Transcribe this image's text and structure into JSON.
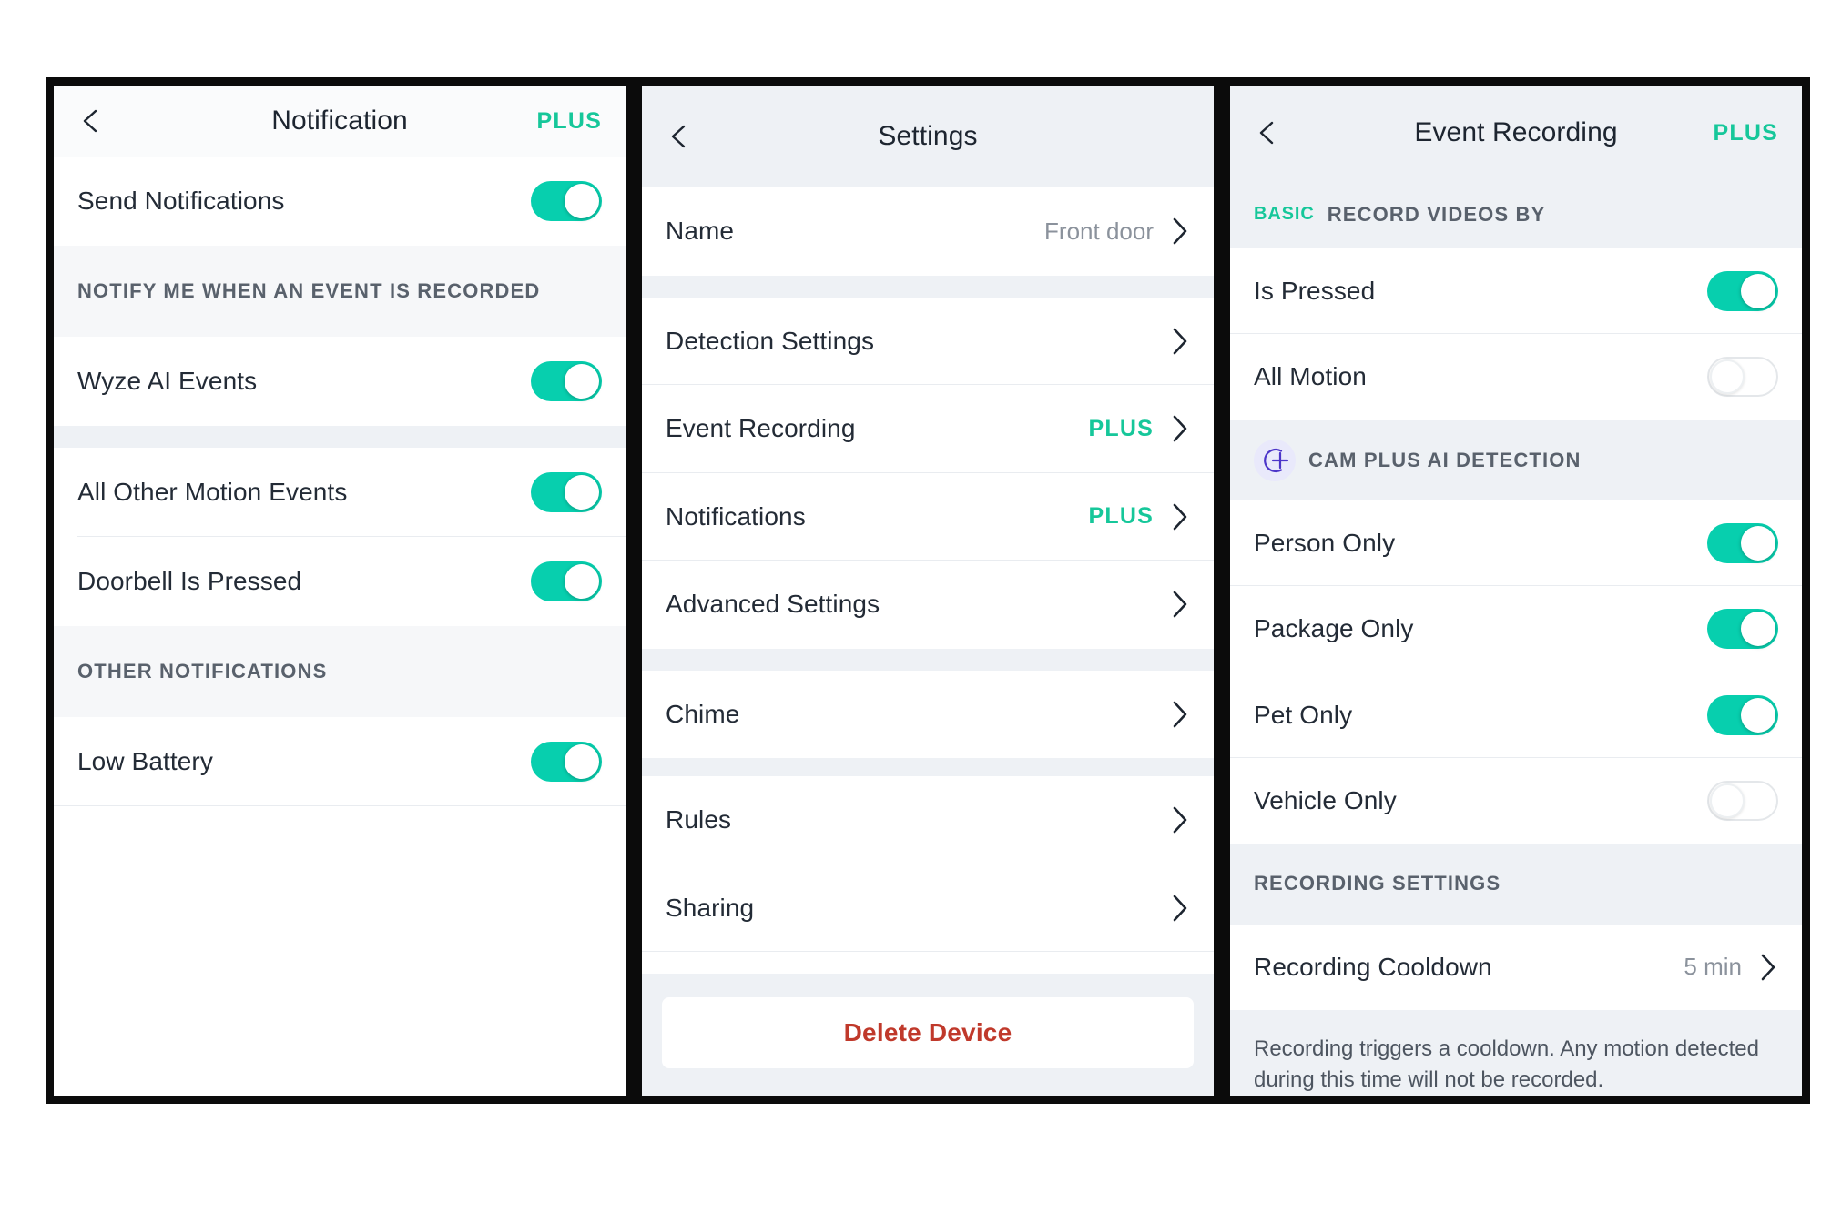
{
  "screens": [
    {
      "id": "notification",
      "nav": {
        "back_icon": "chevron-left-icon",
        "title": "Notification",
        "plus_badge": "PLUS"
      },
      "rows": [
        {
          "label": "Send Notifications",
          "toggle": "on"
        }
      ],
      "section_1": {
        "title": "NOTIFY ME WHEN AN EVENT IS RECORDED",
        "rows": [
          {
            "label": "Wyze AI Events",
            "toggle": "on"
          },
          {
            "label": "All Other Motion Events",
            "toggle": "on"
          },
          {
            "label": "Doorbell Is Pressed",
            "toggle": "on"
          }
        ]
      },
      "section_2": {
        "title": "OTHER NOTIFICATIONS",
        "rows": [
          {
            "label": "Low Battery",
            "toggle": "on"
          }
        ]
      }
    },
    {
      "id": "settings",
      "nav": {
        "back_icon": "chevron-left-icon",
        "title": "Settings"
      },
      "group_1": [
        {
          "label": "Name",
          "value": "Front door",
          "chevron": "chevron-right-icon"
        }
      ],
      "group_2": [
        {
          "label": "Detection Settings",
          "value": "",
          "badge": "",
          "chevron": "chevron-right-icon"
        },
        {
          "label": "Event Recording",
          "value": "",
          "badge": "PLUS",
          "chevron": "chevron-right-icon"
        },
        {
          "label": "Notifications",
          "value": "",
          "badge": "PLUS",
          "chevron": "chevron-right-icon"
        },
        {
          "label": "Advanced Settings",
          "value": "",
          "badge": "",
          "chevron": "chevron-right-icon"
        }
      ],
      "group_3": [
        {
          "label": "Chime",
          "chevron": "chevron-right-icon"
        }
      ],
      "group_4": [
        {
          "label": "Rules",
          "chevron": "chevron-right-icon"
        },
        {
          "label": "Sharing",
          "chevron": "chevron-right-icon"
        }
      ],
      "delete_button": "Delete Device"
    },
    {
      "id": "event-recording",
      "nav": {
        "back_icon": "chevron-left-icon",
        "title": "Event Recording",
        "plus_badge": "PLUS"
      },
      "section_basic": {
        "tag": "BASIC",
        "title": "RECORD VIDEOS BY",
        "rows": [
          {
            "label": "Is Pressed",
            "toggle": "on"
          },
          {
            "label": "All Motion",
            "toggle": "off"
          }
        ]
      },
      "section_camplus": {
        "icon": "cam-plus-icon",
        "title": "CAM PLUS AI DETECTION",
        "rows": [
          {
            "label": "Person Only",
            "toggle": "on"
          },
          {
            "label": "Package Only",
            "toggle": "on"
          },
          {
            "label": "Pet Only",
            "toggle": "on"
          },
          {
            "label": "Vehicle Only",
            "toggle": "off"
          }
        ]
      },
      "section_recording": {
        "title": "RECORDING SETTINGS",
        "rows": [
          {
            "label": "Recording Cooldown",
            "value": "5 min",
            "chevron": "chevron-right-icon"
          }
        ],
        "footnote": "Recording triggers a cooldown. Any motion detected during this time will not be recorded."
      }
    }
  ],
  "colors": {
    "accent_teal": "#07cfae",
    "plus_green": "#16c79a",
    "delete_red": "#c0392b",
    "camplus_purple": "#4c35c9",
    "section_gray": "#59616c",
    "tint_bg": "#eef1f5"
  }
}
